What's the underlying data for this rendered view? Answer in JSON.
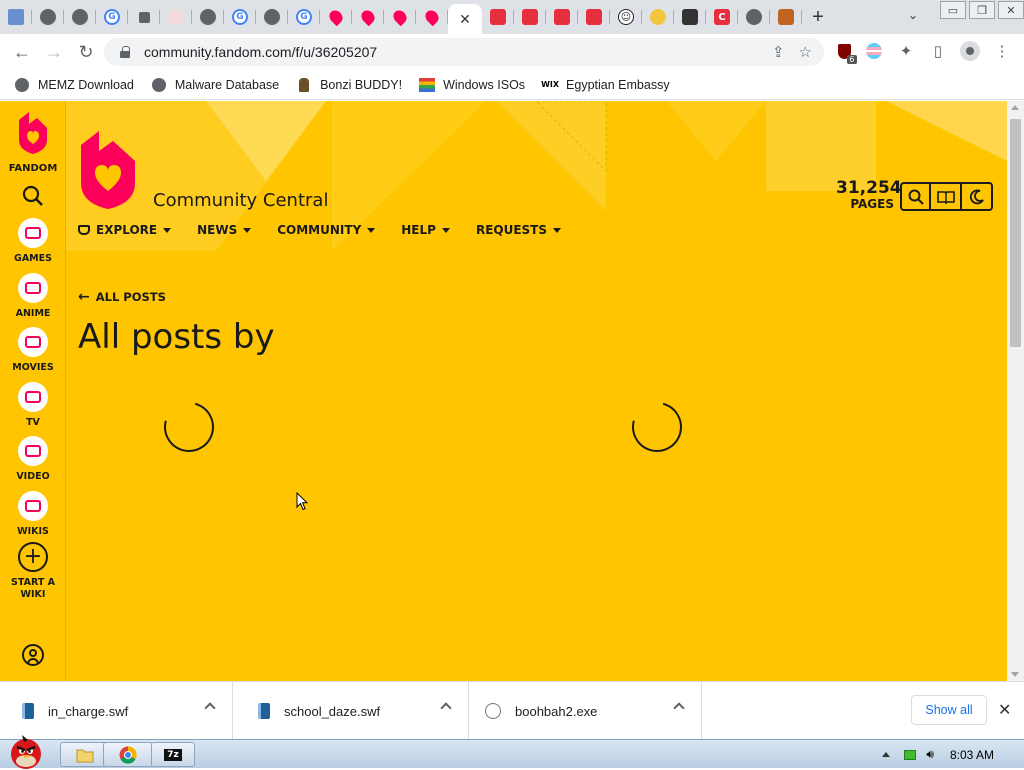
{
  "browser": {
    "tab_close": "✕",
    "new_tab": "+",
    "tab_menu": "⌄",
    "window_buttons": [
      "▭",
      "❐",
      "✕"
    ],
    "url": "community.fandom.com/f/u/36205207",
    "ublock_badge": "6"
  },
  "bookmarks": [
    {
      "label": "MEMZ Download",
      "icon": "globe-icon"
    },
    {
      "label": "Malware Database",
      "icon": "globe-icon"
    },
    {
      "label": "Bonzi BUDDY!",
      "icon": "bonzi-icon"
    },
    {
      "label": "Windows ISOs",
      "icon": "windows-flag-icon"
    },
    {
      "label": "Egyptian Embassy",
      "icon": "wix-icon",
      "icon_text": "WIX"
    }
  ],
  "sidebar": {
    "brand": "FANDOM",
    "items": [
      {
        "label": "GAMES",
        "icon": "gamepad-icon"
      },
      {
        "label": "ANIME",
        "icon": "anime-icon"
      },
      {
        "label": "MOVIES",
        "icon": "clapper-icon"
      },
      {
        "label": "TV",
        "icon": "tv-icon"
      },
      {
        "label": "VIDEO",
        "icon": "play-icon"
      },
      {
        "label": "WIKIS",
        "icon": "book-icon"
      }
    ],
    "start_wiki": "START A WIKI"
  },
  "header": {
    "wiki_name": "Community Central",
    "page_count": "31,254",
    "page_label": "PAGES",
    "nav": [
      "EXPLORE",
      "NEWS",
      "COMMUNITY",
      "HELP",
      "REQUESTS"
    ]
  },
  "content": {
    "back_link": "ALL POSTS",
    "title": "All posts by"
  },
  "downloads": {
    "items": [
      {
        "name": "in_charge.swf"
      },
      {
        "name": "school_daze.swf"
      },
      {
        "name": "boohbah2.exe"
      }
    ],
    "show_all": "Show all",
    "close": "✕"
  },
  "taskbar": {
    "time": "8:03 AM",
    "seven_zip": "7z"
  },
  "colors": {
    "fandom_yellow": "#ffc500",
    "fandom_pink": "#fa005a"
  }
}
